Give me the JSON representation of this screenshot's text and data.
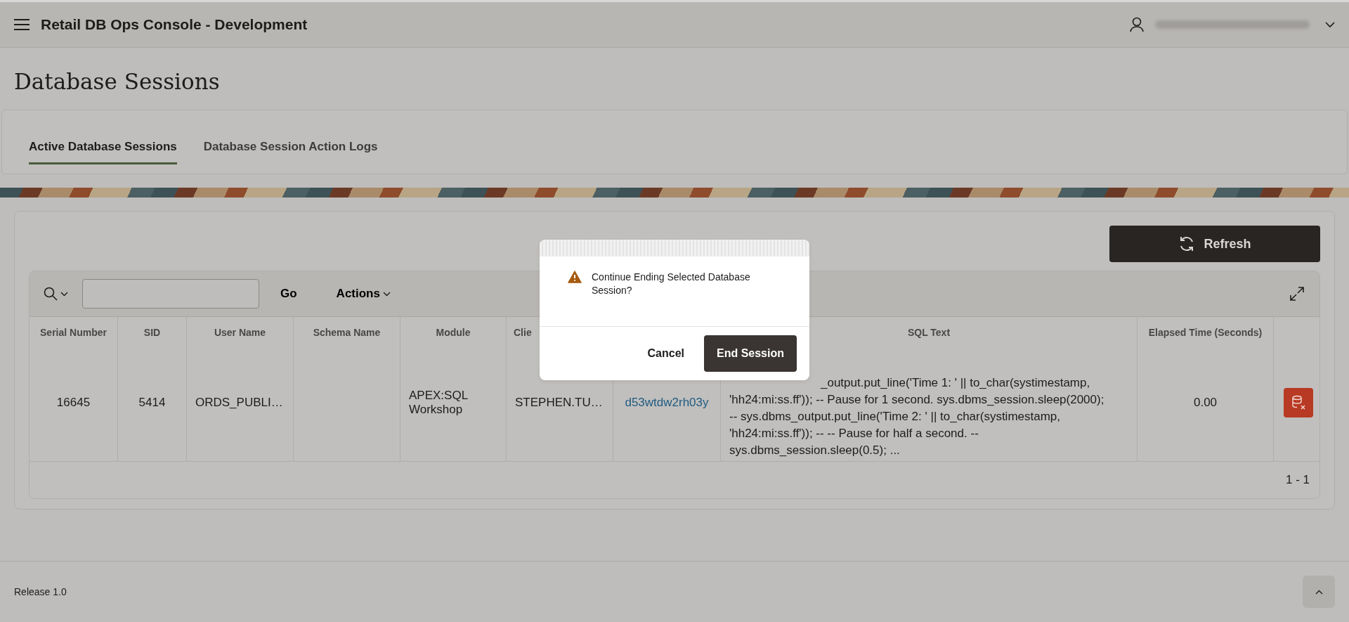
{
  "header": {
    "app_title": "Retail DB Ops Console - Development"
  },
  "page": {
    "title": "Database Sessions"
  },
  "tabs": [
    {
      "label": "Active Database Sessions",
      "selected": true
    },
    {
      "label": "Database Session Action Logs",
      "selected": false
    }
  ],
  "refresh_button": {
    "label": "Refresh"
  },
  "toolbar": {
    "go_button": "Go",
    "actions_menu": "Actions"
  },
  "table": {
    "columns": [
      {
        "kind": "heading",
        "label": "Serial Number"
      },
      {
        "kind": "heading",
        "label": "SID"
      },
      {
        "kind": "heading",
        "label": "User Name"
      },
      {
        "kind": "heading",
        "label": "Schema Name"
      },
      {
        "kind": "heading",
        "label": "Module"
      },
      {
        "kind": "heading",
        "label": "Clie"
      },
      {
        "kind": "blank"
      },
      {
        "kind": "heading",
        "label": "SQL Text"
      },
      {
        "kind": "heading",
        "label": "Elapsed Time (Seconds)"
      },
      {
        "kind": "blank"
      }
    ],
    "rows": [
      {
        "cells": [
          {
            "kind": "text",
            "text": "16645"
          },
          {
            "kind": "text",
            "text": "5414"
          },
          {
            "kind": "text",
            "text": "ORDS_PUBLI…"
          },
          {
            "kind": "empty"
          },
          {
            "kind": "text",
            "text": "APEX:SQL Workshop"
          },
          {
            "kind": "text",
            "text": "STEPHEN.TU…"
          },
          {
            "kind": "link",
            "text": "d53wtdw2rh03y"
          },
          {
            "kind": "lines",
            "lines": [
              "_output.put_line('Time 1: ' || to_char(systimestamp,",
              "'hh24:mi:ss.ff')); -- Pause for 1 second. sys.dbms_session.sleep(2000);",
              "-- sys.dbms_output.put_line('Time 2: ' || to_char(systimestamp,",
              "'hh24:mi:ss.ff')); -- -- Pause for half a second. --",
              "sys.dbms_session.sleep(0.5); ..."
            ]
          },
          {
            "kind": "number",
            "text": "0.00"
          },
          {
            "kind": "delete-button"
          }
        ]
      }
    ],
    "pagination": "1 - 1"
  },
  "dialog": {
    "message": "Continue Ending Selected Database Session?",
    "cancel": "Cancel",
    "confirm": "End Session"
  },
  "footer": {
    "release": "Release 1.0"
  }
}
